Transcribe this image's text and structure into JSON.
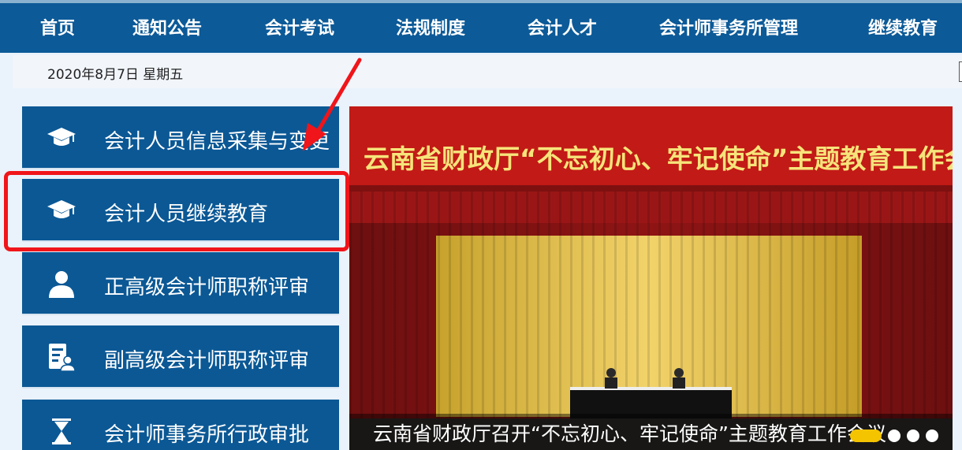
{
  "nav": {
    "items": [
      {
        "label": "首页"
      },
      {
        "label": "通知公告"
      },
      {
        "label": "会计考试"
      },
      {
        "label": "法规制度"
      },
      {
        "label": "会计人才"
      },
      {
        "label": "会计师事务所管理"
      },
      {
        "label": "继续教育"
      }
    ]
  },
  "datebar": {
    "date": "2020年8月7日 星期五"
  },
  "sidebar": {
    "items": [
      {
        "label": "会计人员信息采集与变更",
        "icon": "graduation-cap-icon"
      },
      {
        "label": "会计人员继续教育",
        "icon": "graduation-cap-icon"
      },
      {
        "label": "正高级会计师职称评审",
        "icon": "person-icon"
      },
      {
        "label": "副高级会计师职称评审",
        "icon": "document-person-icon"
      },
      {
        "label": "会计师事务所行政审批",
        "icon": "hourglass-icon"
      }
    ]
  },
  "banner": {
    "slogan": "云南省财政厅“不忘初心、牢记使命”主题教育工作会议",
    "caption": "云南省财政厅召开“不忘初心、牢记使命”主题教育工作会议"
  },
  "colors": {
    "nav_bg": "#0c5a98",
    "button_bg": "#0b5895",
    "highlight": "#f0151a",
    "dot_active": "#f5c400"
  }
}
